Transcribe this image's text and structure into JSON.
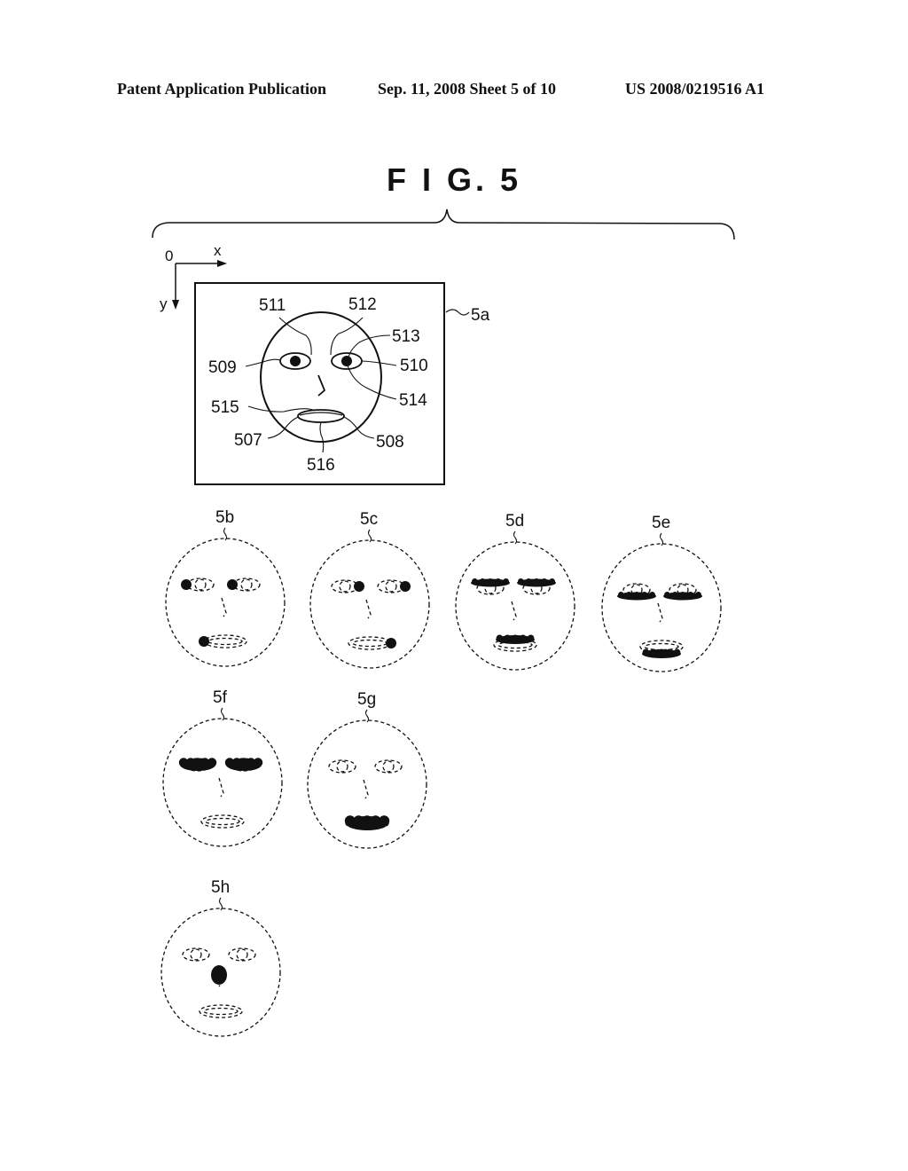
{
  "header": {
    "publication": "Patent Application Publication",
    "date_sheet": "Sep. 11, 2008   Sheet 5 of 10",
    "number": "US 2008/0219516 A1"
  },
  "figure": {
    "title": "F I G. 5",
    "axes": {
      "origin": "0",
      "x": "x",
      "y": "y"
    },
    "main": {
      "label": "5a",
      "refs": [
        "511",
        "512",
        "513",
        "509",
        "510",
        "514",
        "515",
        "507",
        "508",
        "516"
      ]
    },
    "variants": [
      {
        "label": "5b",
        "highlight": "left corners of eyes and mouth (dots)"
      },
      {
        "label": "5c",
        "highlight": "right corners of eyes and mouth (dots)"
      },
      {
        "label": "5d",
        "highlight": "upper eyelids and upper lip"
      },
      {
        "label": "5e",
        "highlight": "lower eyelids and lower lip"
      },
      {
        "label": "5f",
        "highlight": "whole eyes"
      },
      {
        "label": "5g",
        "highlight": "whole mouth"
      },
      {
        "label": "5h",
        "highlight": "nose"
      }
    ]
  }
}
